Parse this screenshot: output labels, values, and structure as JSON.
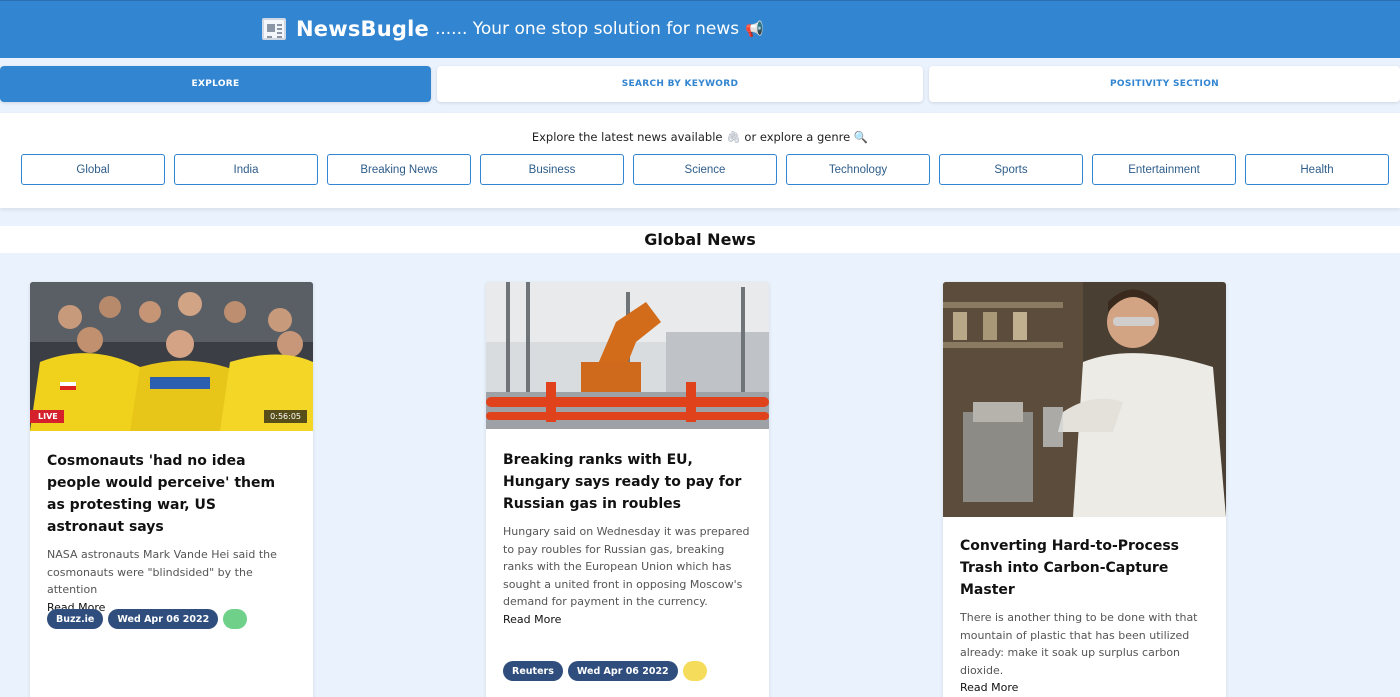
{
  "header": {
    "brand_name": "NewsBugle",
    "tagline": "...... Your one stop solution for news",
    "brand_icon": "newspaper-icon",
    "horn_icon": "megaphone-icon",
    "background": "#3285d0"
  },
  "tabs": [
    {
      "label": "EXPLORE",
      "active": true
    },
    {
      "label": "SEARCH BY KEYWORD",
      "active": false
    },
    {
      "label": "POSITIVITY SECTION",
      "active": false
    }
  ],
  "genre_panel": {
    "prompt_part1": "Explore the latest news available",
    "prompt_part2": "or explore a genre",
    "genres": [
      "Global",
      "India",
      "Breaking News",
      "Business",
      "Science",
      "Technology",
      "Sports",
      "Entertainment",
      "Health"
    ]
  },
  "section": {
    "title": "Global News"
  },
  "cards": [
    {
      "title": "Cosmonauts 'had no idea people would perceive' them as protesting war, US astronaut says",
      "description": "NASA astronauts Mark Vande Hei said the cosmonauts were \"blindsided\" by the attention",
      "read_more": "Read More",
      "source": "Buzz.ie",
      "date": "Wed Apr 06 2022",
      "sentiment_color": "#6fd08a",
      "live_label": "LIVE",
      "clock": "0:56:05"
    },
    {
      "title": "Breaking ranks with EU, Hungary says ready to pay for Russian gas in roubles",
      "description": "Hungary said on Wednesday it was prepared to pay roubles for Russian gas, breaking ranks with the European Union which has sought a united front in opposing Moscow's demand for payment in the currency.",
      "read_more": "Read More",
      "source": "Reuters",
      "date": "Wed Apr 06 2022",
      "sentiment_color": "#f5dc5a"
    },
    {
      "title": "Converting Hard-to-Process Trash into Carbon-Capture Master",
      "description": "There is another thing to be done with that mountain of plastic that has been utilized already: make it soak up surplus carbon dioxide.",
      "read_more": "Read More"
    }
  ]
}
